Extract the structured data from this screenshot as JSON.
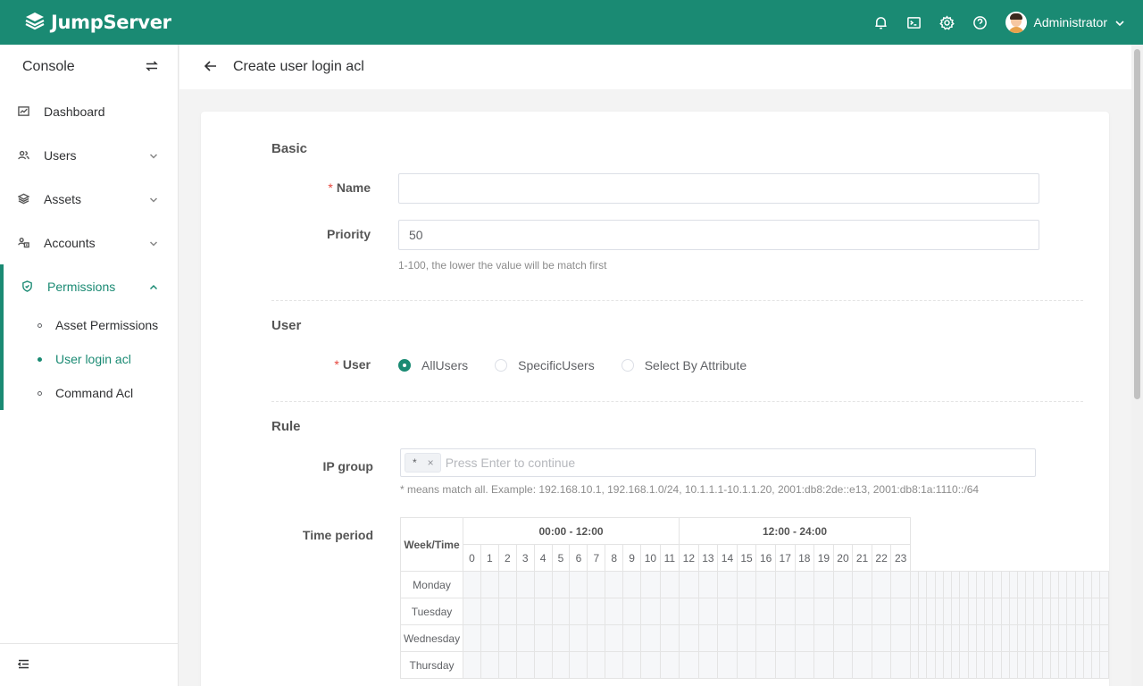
{
  "brand": {
    "name": "JumpServer"
  },
  "header": {
    "user_name": "Administrator"
  },
  "sidebar": {
    "console_label": "Console",
    "items": [
      {
        "label": "Dashboard"
      },
      {
        "label": "Users"
      },
      {
        "label": "Assets"
      },
      {
        "label": "Accounts"
      },
      {
        "label": "Permissions"
      }
    ],
    "sub_items": [
      {
        "label": "Asset Permissions"
      },
      {
        "label": "User login acl"
      },
      {
        "label": "Command Acl"
      }
    ]
  },
  "page": {
    "title": "Create user login acl"
  },
  "form": {
    "basic_title": "Basic",
    "name_label": "Name",
    "name_value": "",
    "priority_label": "Priority",
    "priority_value": "50",
    "priority_hint": "1-100, the lower the value will be match first",
    "user_title": "User",
    "user_label": "User",
    "user_options": [
      "AllUsers",
      "SpecificUsers",
      "Select By Attribute"
    ],
    "user_selected": "AllUsers",
    "rule_title": "Rule",
    "ip_label": "IP group",
    "ip_tag": "*",
    "ip_placeholder": "Press Enter to continue",
    "ip_hint": "* means match all. Example: 192.168.10.1, 192.168.1.0/24, 10.1.1.1-10.1.1.20, 2001:db8:2de::e13, 2001:db8:1a:1110::/64",
    "time_label": "Time period"
  },
  "time_table": {
    "corner": "Week/Time",
    "ranges": [
      "00:00 - 12:00",
      "12:00 - 24:00"
    ],
    "hours": [
      "0",
      "1",
      "2",
      "3",
      "4",
      "5",
      "6",
      "7",
      "8",
      "9",
      "10",
      "11",
      "12",
      "13",
      "14",
      "15",
      "16",
      "17",
      "18",
      "19",
      "20",
      "21",
      "22",
      "23"
    ],
    "days": [
      "Monday",
      "Tuesday",
      "Wednesday",
      "Thursday"
    ]
  },
  "colors": {
    "brand": "#1a8a73",
    "required": "#e6453c"
  }
}
